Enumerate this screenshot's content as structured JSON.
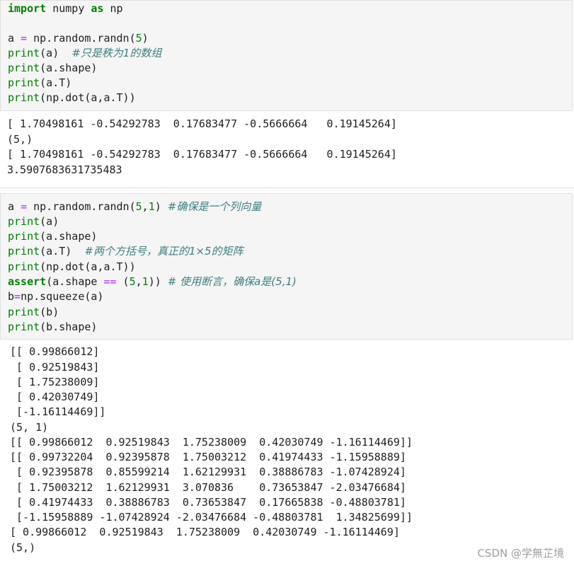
{
  "cell1": {
    "l1_kw1": "import",
    "l1_mid": " numpy ",
    "l1_kw2": "as",
    "l1_end": " np",
    "l3_a": "a ",
    "l3_eq": "=",
    "l3_b": " np.random.randn(",
    "l3_n": "5",
    "l3_c": ")",
    "l4_print": "print",
    "l4_args": "(a)  ",
    "l4_comment": "#只是秩为1的数组",
    "l5_print": "print",
    "l5_args": "(a.shape)",
    "l6_print": "print",
    "l6_args": "(a.T)",
    "l7_print": "print",
    "l7_args": "(np.dot(a,a.T))"
  },
  "output1": {
    "lines": [
      "[ 1.70498161 -0.54292783  0.17683477 -0.5666664   0.19145264]",
      "(5,)",
      "[ 1.70498161 -0.54292783  0.17683477 -0.5666664   0.19145264]",
      "3.5907683631735483"
    ]
  },
  "cell2": {
    "l1_a": "a ",
    "l1_eq": "=",
    "l1_b": " np.random.randn(",
    "l1_n1": "5",
    "l1_comma": ",",
    "l1_n2": "1",
    "l1_c": ") ",
    "l1_comment": "#确保是一个列向量",
    "l2_print": "print",
    "l2_args": "(a)",
    "l3_print": "print",
    "l3_args": "(a.shape)",
    "l4_print": "print",
    "l4_args": "(a.T)  ",
    "l4_comment": "#两个方括号，真正的1×5的矩阵",
    "l5_print": "print",
    "l5_args": "(np.dot(a,a.T))",
    "l6_kw": "assert",
    "l6_a": "(a.shape ",
    "l6_eq": "==",
    "l6_b": " (",
    "l6_n1": "5",
    "l6_comma": ",",
    "l6_n2": "1",
    "l6_c": ")) ",
    "l6_comment": "# 使用断言，确保a是(5,1)",
    "l7_a": "b",
    "l7_eq": "=",
    "l7_b": "np.squeeze(a)",
    "l8_print": "print",
    "l8_args": "(b)",
    "l9_print": "print",
    "l9_args": "(b.shape)"
  },
  "output2": {
    "lines": [
      "[[ 0.99866012]",
      " [ 0.92519843]",
      " [ 1.75238009]",
      " [ 0.42030749]",
      " [-1.16114469]]",
      "(5, 1)",
      "[[ 0.99866012  0.92519843  1.75238009  0.42030749 -1.16114469]]",
      "[[ 0.99732204  0.92395878  1.75003212  0.41974433 -1.15958889]",
      " [ 0.92395878  0.85599214  1.62129931  0.38886783 -1.07428924]",
      " [ 1.75003212  1.62129931  3.070836    0.73653847 -2.03476684]",
      " [ 0.41974433  0.38886783  0.73653847  0.17665838 -0.48803781]",
      " [-1.15958889 -1.07428924 -2.03476684 -0.48803781  1.34825699]]",
      "[ 0.99866012  0.92519843  1.75238009  0.42030749 -1.16114469]",
      "(5,)"
    ]
  },
  "watermark": "CSDN @学無芷境"
}
